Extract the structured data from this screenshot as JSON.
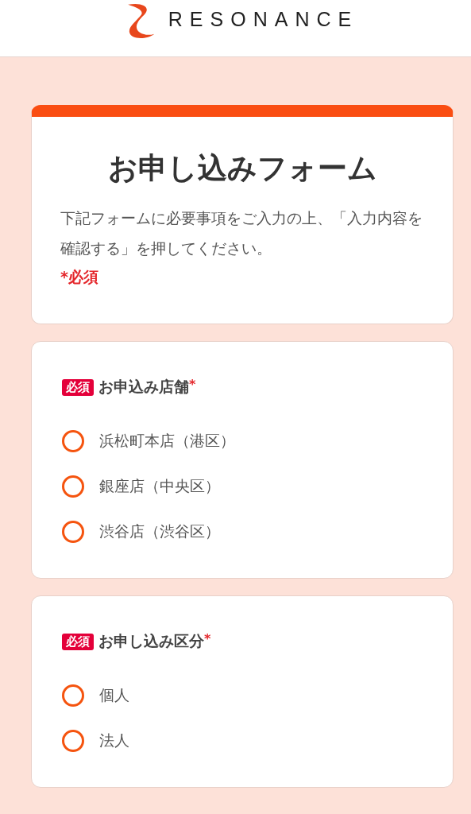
{
  "header": {
    "logo_text": "RESONANCE"
  },
  "intro": {
    "title": "お申し込みフォーム",
    "description": "下記フォームに必要事項をご入力の上、「入力内容を確認する」を押してください。",
    "required_note": "*必須"
  },
  "questions": [
    {
      "badge": "必須",
      "label": "お申込み店舗",
      "required_mark": "*",
      "options": [
        {
          "label": "浜松町本店（港区）",
          "selected": false
        },
        {
          "label": "銀座店（中央区）",
          "selected": false
        },
        {
          "label": "渋谷店（渋谷区）",
          "selected": false
        }
      ]
    },
    {
      "badge": "必須",
      "label": "お申し込み区分",
      "required_mark": "*",
      "options": [
        {
          "label": "個人",
          "selected": false
        },
        {
          "label": "法人",
          "selected": false
        }
      ]
    }
  ]
}
